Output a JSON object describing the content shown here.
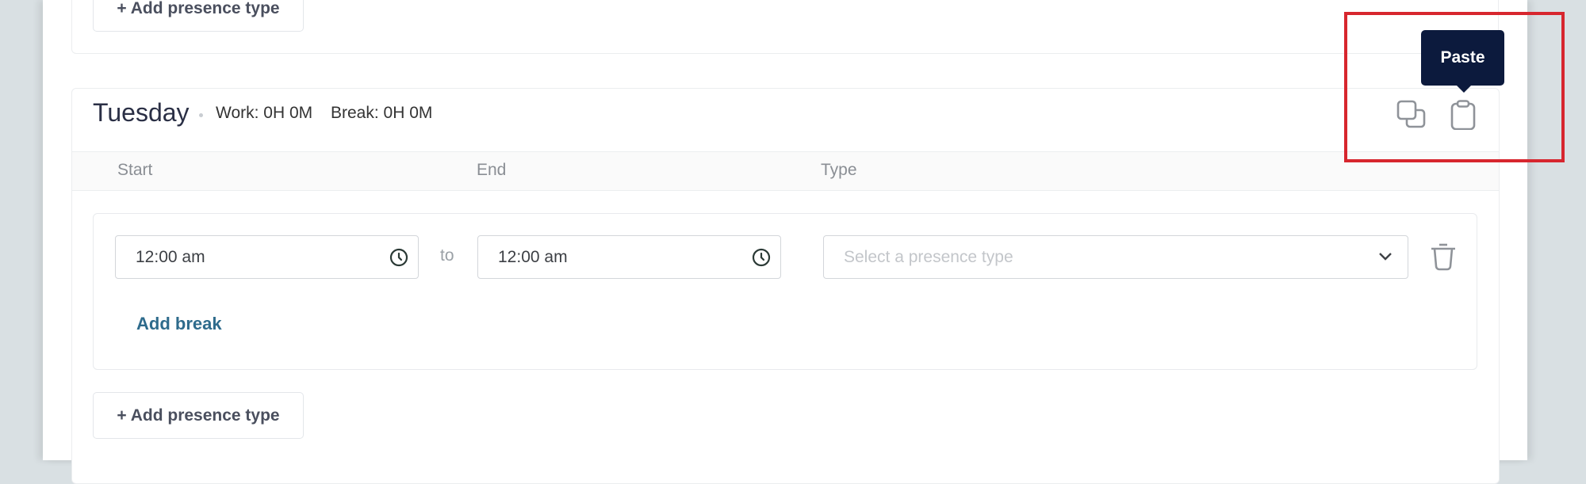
{
  "previous_day": {
    "add_presence_type_label": "+ Add presence type"
  },
  "day": {
    "name": "Tuesday",
    "work_summary": "Work: 0H 0M",
    "break_summary": "Break: 0H 0M",
    "columns": {
      "start": "Start",
      "end": "End",
      "type": "Type"
    },
    "entries": [
      {
        "start_value": "12:00 am",
        "separator": "to",
        "end_value": "12:00 am",
        "type_placeholder": "Select a presence type",
        "type_value": "",
        "add_break_label": "Add break"
      }
    ],
    "add_presence_type_label": "+ Add presence type",
    "actions": {
      "copy_icon": "copy-icon",
      "paste_icon": "clipboard-icon"
    }
  },
  "tooltip": {
    "text": "Paste"
  },
  "colors": {
    "tooltip_bg": "#0c1a3d",
    "link": "#2e6b8c",
    "highlight": "#d7262e"
  }
}
